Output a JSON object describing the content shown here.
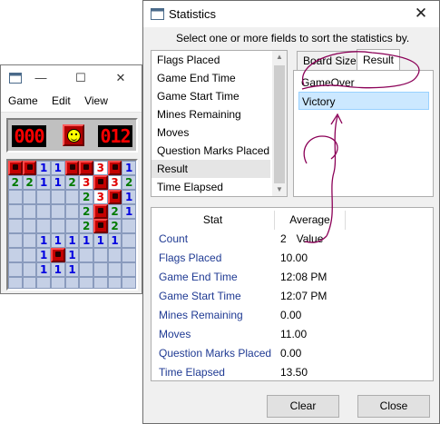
{
  "minesweeper": {
    "menu": [
      "Game",
      "Edit",
      "View"
    ],
    "mines_counter": "000",
    "timer": "012",
    "board": [
      [
        "F",
        "F",
        "1",
        "1",
        "F",
        "F",
        "3",
        "F",
        "1"
      ],
      [
        "2",
        "2",
        "1",
        "1",
        "2",
        "3",
        "F",
        "3",
        "2"
      ],
      [
        "C",
        "C",
        "C",
        "C",
        "C",
        "2",
        "3",
        "F",
        "1"
      ],
      [
        "C",
        "C",
        "C",
        "C",
        "C",
        "2",
        "F",
        "2",
        "1"
      ],
      [
        "C",
        "C",
        "C",
        "C",
        "C",
        "2",
        "F",
        "2",
        "C"
      ],
      [
        "C",
        "C",
        "1",
        "1",
        "1",
        "1",
        "1",
        "1",
        "C"
      ],
      [
        "C",
        "C",
        "1",
        "F",
        "1",
        "C",
        "C",
        "C",
        "C"
      ],
      [
        "C",
        "C",
        "1",
        "1",
        "1",
        "C",
        "C",
        "C",
        "C"
      ],
      [
        "C",
        "C",
        "C",
        "C",
        "C",
        "C",
        "C",
        "C",
        "C"
      ]
    ]
  },
  "dialog": {
    "title": "Statistics",
    "instruction": "Select one or more fields to sort the statistics by.",
    "fields": [
      {
        "label": "Flags Placed",
        "selected": false
      },
      {
        "label": "Game End Time",
        "selected": false
      },
      {
        "label": "Game Start Time",
        "selected": false
      },
      {
        "label": "Mines Remaining",
        "selected": false
      },
      {
        "label": "Moves",
        "selected": false
      },
      {
        "label": "Question Marks Placed",
        "selected": false
      },
      {
        "label": "Result",
        "selected": true
      },
      {
        "label": "Time Elapsed",
        "selected": false
      }
    ],
    "tabs": {
      "board_size": "Board Size",
      "result": "Result"
    },
    "result_values": [
      {
        "label": "GameOver",
        "selected": false
      },
      {
        "label": "Victory",
        "selected": true
      }
    ],
    "table": {
      "col_stat": "Stat",
      "col_value": "Average Value",
      "rows": [
        {
          "stat": "Count",
          "value": "2"
        },
        {
          "stat": "Flags Placed",
          "value": "10.00"
        },
        {
          "stat": "Game End Time",
          "value": "12:08 PM"
        },
        {
          "stat": "Game Start Time",
          "value": "12:07 PM"
        },
        {
          "stat": "Mines Remaining",
          "value": "0.00"
        },
        {
          "stat": "Moves",
          "value": "11.00"
        },
        {
          "stat": "Question Marks Placed",
          "value": "0.00"
        },
        {
          "stat": "Time Elapsed",
          "value": "13.50"
        }
      ]
    },
    "buttons": {
      "clear": "Clear",
      "close": "Close"
    }
  },
  "colors": {
    "accent_select": "#cce8ff",
    "stat_text": "#1f3a93",
    "annotation": "#8b0057"
  }
}
